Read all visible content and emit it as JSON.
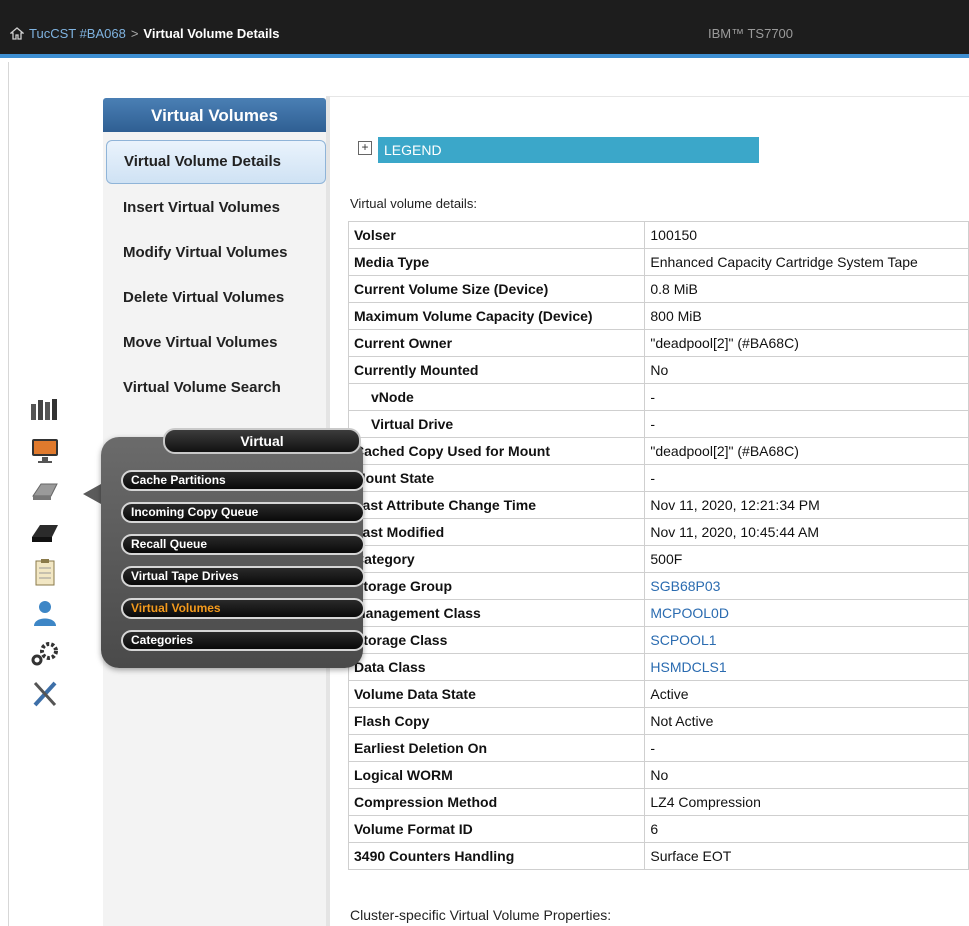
{
  "header": {
    "breadcrumb_link": "TucCST #BA068",
    "separator": ">",
    "current": "Virtual Volume Details",
    "product": "IBM™ TS7700"
  },
  "nav": {
    "title": "Virtual Volumes",
    "items": [
      {
        "label": "Virtual Volume Details",
        "selected": true
      },
      {
        "label": "Insert Virtual Volumes"
      },
      {
        "label": "Modify Virtual Volumes"
      },
      {
        "label": "Delete Virtual Volumes"
      },
      {
        "label": "Move Virtual Volumes"
      },
      {
        "label": "Virtual Volume Search"
      }
    ]
  },
  "icon_rail": [
    "cluster-icon",
    "monitor-icon",
    "tape-drive-icon",
    "cartridge-icon",
    "clipboard-icon",
    "user-icon",
    "settings-icon",
    "tools-icon"
  ],
  "popup": {
    "title": "Virtual",
    "items": [
      {
        "label": "Cache Partitions"
      },
      {
        "label": "Incoming Copy Queue"
      },
      {
        "label": "Recall Queue"
      },
      {
        "label": "Virtual Tape Drives"
      },
      {
        "label": "Virtual Volumes",
        "active": true
      },
      {
        "label": "Categories"
      }
    ],
    "active_color": "#f39a1d"
  },
  "content": {
    "legend": "LEGEND",
    "legend_toggle": "+",
    "details_caption": "Virtual volume details:",
    "rows": [
      {
        "key": "Volser",
        "value": "100150"
      },
      {
        "key": "Media Type",
        "value": "Enhanced Capacity Cartridge System Tape"
      },
      {
        "key": "Current Volume Size (Device)",
        "value": "0.8 MiB"
      },
      {
        "key": "Maximum Volume Capacity (Device)",
        "value": "800 MiB"
      },
      {
        "key": "Current Owner",
        "value": "\"deadpool[2]\" (#BA68C)"
      },
      {
        "key": "Currently Mounted",
        "value": "No"
      },
      {
        "key": "vNode",
        "value": "-"
      },
      {
        "key": "Virtual Drive",
        "value": "-"
      },
      {
        "key": "Cached Copy Used for Mount",
        "value": "\"deadpool[2]\" (#BA68C)"
      },
      {
        "key": "Mount State",
        "value": "-"
      },
      {
        "key": "Last Attribute Change Time",
        "value": "Nov 11, 2020, 12:21:34 PM"
      },
      {
        "key": "Last Modified",
        "value": "Nov 11, 2020, 10:45:44 AM"
      },
      {
        "key": "Category",
        "value": "500F"
      },
      {
        "key": "Storage Group",
        "value": "SGB68P03"
      },
      {
        "key": "Management Class",
        "value": "MCPOOL0D"
      },
      {
        "key": "Storage Class",
        "value": "SCPOOL1"
      },
      {
        "key": "Data Class",
        "value": "HSMDCLS1"
      },
      {
        "key": "Volume Data State",
        "value": "Active"
      },
      {
        "key": "Flash Copy",
        "value": "Not Active"
      },
      {
        "key": "Earliest Deletion On",
        "value": "-"
      },
      {
        "key": "Logical WORM",
        "value": "No"
      },
      {
        "key": "Compression Method",
        "value": "LZ4 Compression"
      },
      {
        "key": "Volume Format ID",
        "value": "6"
      },
      {
        "key": "3490 Counters Handling",
        "value": "Surface EOT"
      }
    ],
    "cluster_caption": "Cluster-specific Virtual Volume Properties:"
  },
  "colors": {
    "accent": "#3e8fd2",
    "legend_bg": "#3ba7c9",
    "link": "#2a6bb0"
  }
}
